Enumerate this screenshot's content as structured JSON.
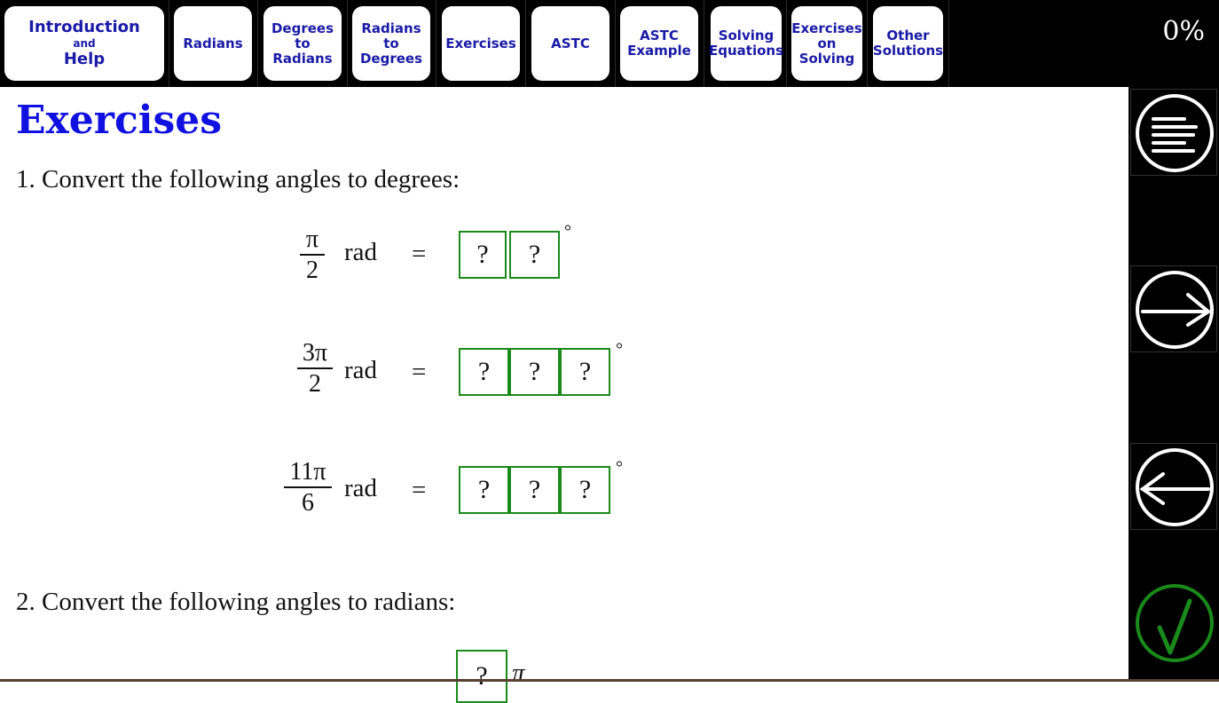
{
  "nav": {
    "items": [
      {
        "line1": "Introduction",
        "line2": "and",
        "line3": "Help"
      },
      {
        "label": "Radians"
      },
      {
        "line1": "Degrees",
        "line2": "to",
        "line3": "Radians"
      },
      {
        "line1": "Radians",
        "line2": "to",
        "line3": "Degrees"
      },
      {
        "label": "Exercises"
      },
      {
        "label": "ASTC"
      },
      {
        "line1": "ASTC",
        "line2": "Example"
      },
      {
        "line1": "Solving",
        "line2": "Equations"
      },
      {
        "line1": "Exercises",
        "line2": "on",
        "line3": "Solving"
      },
      {
        "line1": "Other",
        "line2": "Solutions"
      }
    ],
    "progress": "0%"
  },
  "sidebar": {
    "buttons": [
      {
        "icon": "menu-icon"
      },
      {
        "icon": "arrow-right-icon"
      },
      {
        "icon": "arrow-left-icon"
      },
      {
        "icon": "check-icon"
      }
    ],
    "accent": "#1a8a1a"
  },
  "content": {
    "title": "Exercises",
    "q1": "1. Convert the following angles to degrees:",
    "q1_items": [
      {
        "num": "π",
        "den": "2",
        "unit": "rad",
        "equals": "=",
        "boxes": [
          "?",
          "?"
        ],
        "suffix": "°"
      },
      {
        "num": "3π",
        "den": "2",
        "unit": "rad",
        "equals": "=",
        "boxes": [
          "?",
          "?",
          "?"
        ],
        "suffix": "°"
      },
      {
        "num": "11π",
        "den": "6",
        "unit": "rad",
        "equals": "=",
        "boxes": [
          "?",
          "?",
          "?"
        ],
        "suffix": "°"
      }
    ],
    "q2": "2. Convert the following angles to radians:",
    "q2_items": [
      {
        "boxes": [
          "?"
        ],
        "suffix": "π"
      }
    ]
  }
}
